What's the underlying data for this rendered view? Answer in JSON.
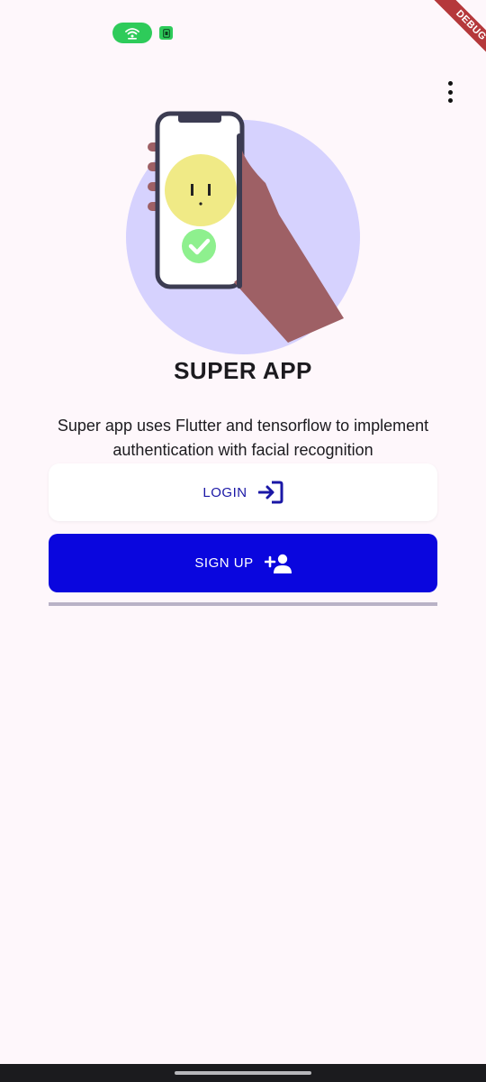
{
  "banner": {
    "debug_label": "DEBUG"
  },
  "status_bar": {
    "hotspot_icon": "wifi-hotspot-icon",
    "sim_icon": "sim-card-icon",
    "accent": "#2ecb5a"
  },
  "app_bar": {
    "menu_icon": "more-vert-icon"
  },
  "hero": {
    "title": "SUPER APP",
    "description": "Super app uses Flutter and tensorflow to implement authentication with facial recognition"
  },
  "actions": {
    "login": {
      "label": "LOGIN",
      "icon": "login-icon",
      "color": "#1a17a6"
    },
    "signup": {
      "label": "SIGN UP",
      "icon": "person-add-icon",
      "background": "#0a06de"
    }
  },
  "progress": {
    "value": 1.0
  },
  "colors": {
    "background": "#fef7fb",
    "illustration_circle": "#d6d2fe",
    "face": "#f0ea86",
    "check": "#8ef08e",
    "hand": "#9e6065"
  }
}
